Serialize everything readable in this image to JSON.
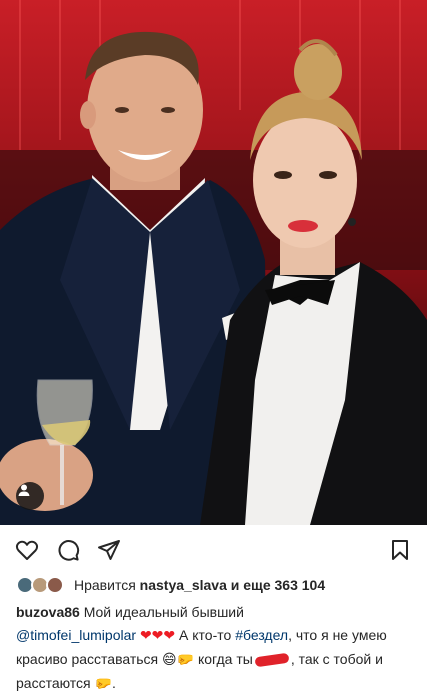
{
  "post": {
    "username": "buzova86",
    "caption": {
      "text_1": "Мой идеальный бывший",
      "mention": "@timofei_lumipolar",
      "hearts": "❤❤❤",
      "text_2": "А кто-то",
      "hashtag": "#бездел",
      "text_3": ", что я не умею красиво расставаться",
      "emoji_1": "😄🤛",
      "text_4": "когда ты",
      "text_5": ", так с тобой и расстаются",
      "emoji_2": "🤛"
    }
  },
  "likes": {
    "prefix": "Нравится",
    "user": "nastya_slava",
    "conjunction": "и",
    "others": "еще 363 104"
  },
  "icons": {
    "like": "heart-icon",
    "comment": "comment-icon",
    "share": "paper-plane-icon",
    "save": "bookmark-icon",
    "tag": "user-tag-icon"
  },
  "colors": {
    "link": "#00376b",
    "text": "#262626",
    "censor": "#e0222a",
    "heart": "#ed1c24"
  }
}
